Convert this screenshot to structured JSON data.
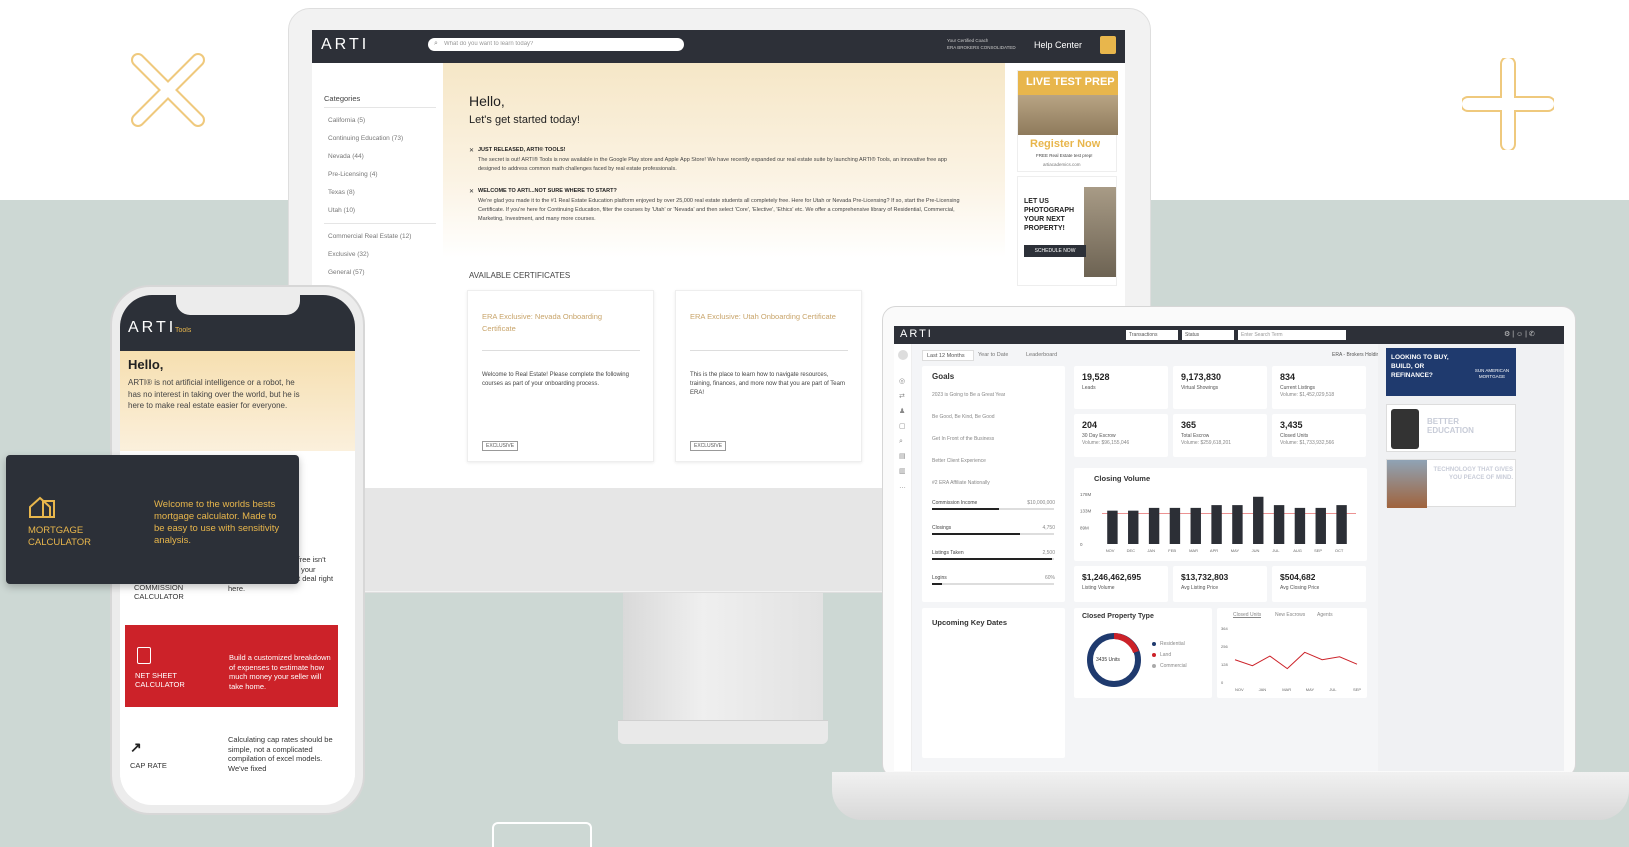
{
  "brand": {
    "gold": "#e8b64c",
    "dark": "#2c3038",
    "red": "#cc2229",
    "navy": "#1f3a6e"
  },
  "desktop": {
    "logo": "ARTI",
    "search_placeholder": "What do you want to learn today?",
    "coach_line1": "Your Certified Coach",
    "coach_line2": "ERA BROKERS CONSOLIDATED",
    "help": "Help Center",
    "categories_title": "Categories",
    "categories": [
      "California (5)",
      "Continuing Education (73)",
      "Nevada (44)",
      "Pre-Licensing (4)",
      "Texas (8)",
      "Utah (10)",
      "Commercial Real Estate (12)",
      "Exclusive (32)",
      "General (57)"
    ],
    "hello": "Hello,",
    "subhello": "Let's get started today!",
    "news1_title": "JUST RELEASED, ARTI® TOOLS!",
    "news1_body": "The secret is out! ARTI® Tools is now available in the Google Play store and Apple App Store! We have recently expanded our real estate suite by launching ARTI® Tools, an innovative free app designed to address common math challenges faced by real estate professionals.",
    "news2_title": "WELCOME TO ARTI...NOT SURE WHERE TO START?",
    "news2_body": "We're glad you made it to the #1 Real Estate Education platform enjoyed by over 25,000 real estate students all completely free. Here for Utah or Nevada Pre-Licensing? If so, start the Pre-Licensing Certificate. If you're here for Continuing Education, filter the courses by 'Utah' or 'Nevada' and then select 'Core', 'Elective', 'Ethics' etc. We offer a comprehensive library of Residential, Commercial, Marketing, Investment, and many more courses.",
    "available": "AVAILABLE CERTIFICATES",
    "cert1_title": "ERA Exclusive: Nevada Onboarding Certificate",
    "cert1_body": "Welcome to Real Estate! Please complete the following courses as part of your onboarding process.",
    "cert2_title": "ERA Exclusive: Utah Onboarding Certificate",
    "cert2_body": "This is the place to learn how to navigate resources, training, finances, and more now that you are part of Team ERA!",
    "tag": "EXCLUSIVE",
    "ad1_head": "LIVE TEST PREP",
    "ad1_cta": "Register Now",
    "ad1_sub": "FREE Real Estate test prep!",
    "ad1_url": "artiacademics.com",
    "ad2_text": "LET US PHOTOGRAPH YOUR NEXT PROPERTY!",
    "ad2_btn": "SCHEDULE NOW"
  },
  "laptop": {
    "logo": "ARTI",
    "filter1": "Transactions",
    "filter2": "Status",
    "search_placeholder": "Enter Search Term",
    "tabs": [
      "Last 12 Months",
      "Year to Date",
      "Leaderboard"
    ],
    "org": "ERA - Brokers Holdings, LLc",
    "goals_title": "Goals",
    "goals": [
      "2023 is Going to Be a Great Year",
      "Be Good, Be Kind, Be Good",
      "Get In Front of the Business",
      "Better Client Experience",
      "#2 ERA Affiliate Nationally"
    ],
    "progress": [
      {
        "label": "Commission Income",
        "value": "$10,000,000",
        "pct": 0.55
      },
      {
        "label": "Closings",
        "value": "4,750",
        "pct": 0.72
      },
      {
        "label": "Listings Taken",
        "value": "2,500",
        "pct": 0.98
      },
      {
        "label": "Logins",
        "value": "60%",
        "pct": 0.08
      }
    ],
    "kpis": [
      {
        "value": "19,528",
        "label": "Leads",
        "sub": ""
      },
      {
        "value": "9,173,830",
        "label": "Virtual Showings",
        "sub": ""
      },
      {
        "value": "834",
        "label": "Current Listings",
        "sub": "Volume: $1,452,029,518"
      },
      {
        "value": "204",
        "label": "30 Day Escrow",
        "sub": "Volume: $96,155,046"
      },
      {
        "value": "365",
        "label": "Total Escrow",
        "sub": "Volume: $259,618,201"
      },
      {
        "value": "3,435",
        "label": "Closed Units",
        "sub": "Volume: $1,733,932,566"
      }
    ],
    "closing_title": "Closing Volume",
    "kpis2": [
      {
        "value": "$1,246,462,695",
        "label": "Listing Volume"
      },
      {
        "value": "$13,732,803",
        "label": "Avg Listing Price"
      },
      {
        "value": "$504,682",
        "label": "Avg Closing Price"
      }
    ],
    "upcoming": "Upcoming Key Dates",
    "cpt_title": "Closed Property Type",
    "donut_label": "3435 Units",
    "legend": [
      "Residential",
      "Land",
      "Commercial"
    ],
    "line_tabs": [
      "Closed Units",
      "New Escrows",
      "Agents"
    ],
    "ad1": "LOOKING TO BUY, BUILD, OR REFINANCE?",
    "ad1_brand": "SUN AMERICAN MORTGAGE",
    "ad2": "BETTER EDUCATION",
    "ad3": "TECHNOLOGY THAT GIVES YOU PEACE OF MIND."
  },
  "chart_data": [
    {
      "type": "bar",
      "title": "Closing Volume",
      "categories": [
        "NOV",
        "DEC",
        "JAN",
        "FEB",
        "MAR",
        "APR",
        "MAY",
        "JUN",
        "JUL",
        "AUG",
        "SEP",
        "OCT"
      ],
      "values": [
        12,
        12,
        13,
        13,
        13,
        14,
        14,
        17,
        14,
        13,
        13,
        14
      ],
      "yticks": [
        "178M",
        "133M",
        "89M",
        "0"
      ]
    },
    {
      "type": "line",
      "series_tabs": [
        "Closed Units",
        "New Escrows",
        "Agents"
      ],
      "categories": [
        "NOV",
        "JAN",
        "MAR",
        "MAY",
        "JUL",
        "SEP"
      ],
      "values": [
        150,
        110,
        175,
        90,
        200,
        150,
        170,
        120
      ],
      "yticks": [
        "364",
        "256",
        "128",
        "0"
      ]
    }
  ],
  "phone": {
    "logo": "ARTI",
    "logo_sub": "Tools",
    "hello": "Hello,",
    "intro": "ARTI® is not artificial intelligence or a robot, he has no interest in taking over the world, but he is here to make real estate easier for everyone.",
    "commission_label": "COMMISSION CALCULATOR",
    "commission_desc": "...ppens, working for free isn't always fun. Calculate your earnings on your next deal right here.",
    "net_label": "NET SHEET CALCULATOR",
    "net_desc": "Build a customized breakdown of expenses to estimate how much money your seller will take home.",
    "cap_label": "CAP RATE",
    "cap_desc": "Calculating cap rates should be simple, not a complicated compilation of excel models. We've fixed"
  },
  "mortgage": {
    "label": "MORTGAGE CALCULATOR",
    "desc": "Welcome to the worlds bests mortgage calculator. Made to be easy to use with sensitivity analysis."
  }
}
